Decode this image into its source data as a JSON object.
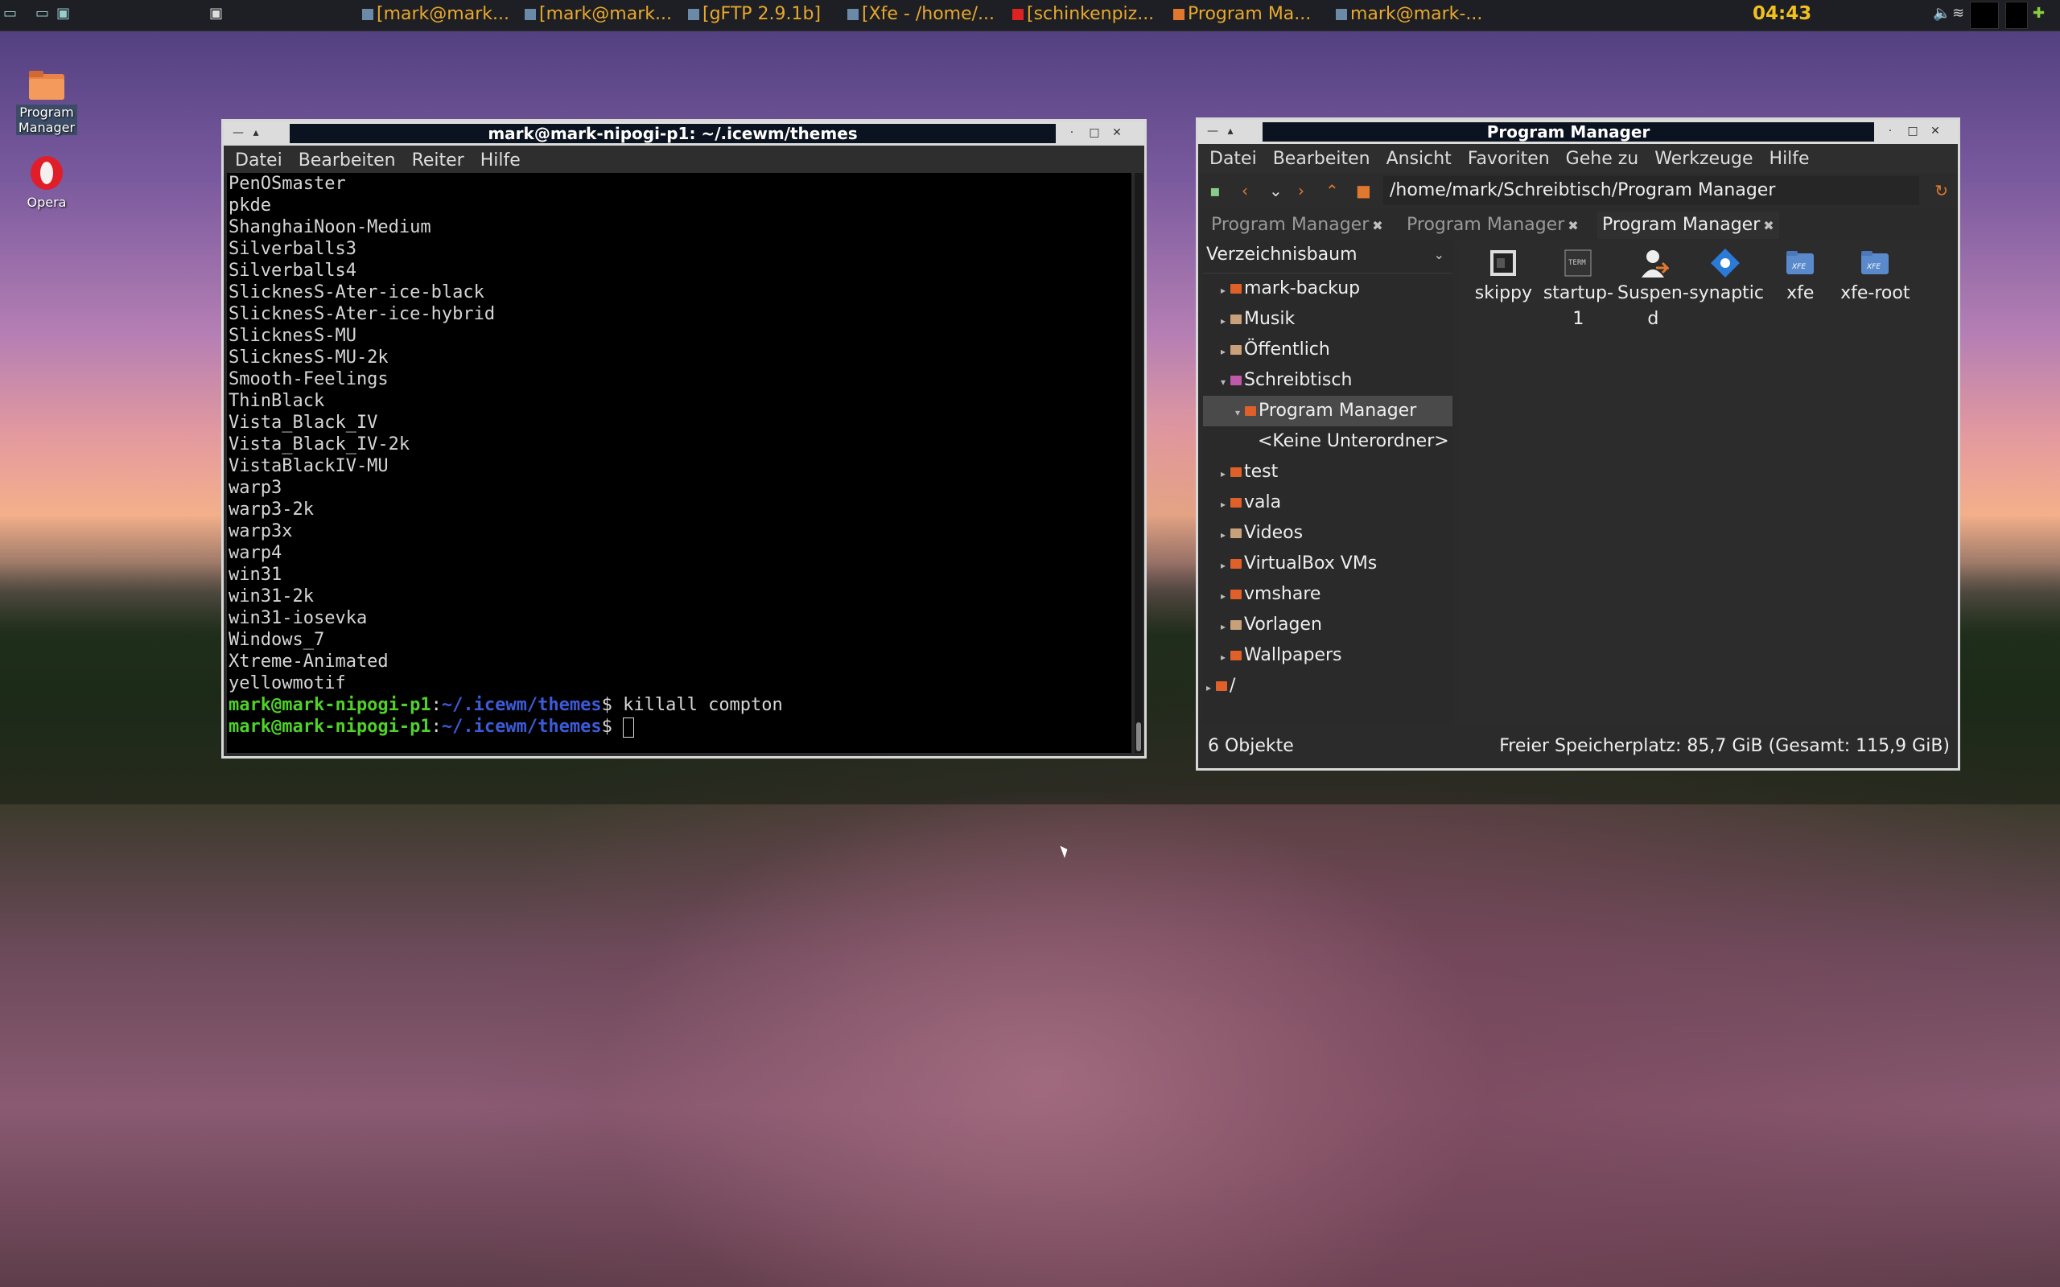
{
  "taskbar": {
    "tasks": [
      {
        "label": "[mark@mark..."
      },
      {
        "label": "[mark@mark..."
      },
      {
        "label": "[gFTP 2.9.1b]"
      },
      {
        "label": "[Xfe - /home/..."
      },
      {
        "label": "[schinkenpiz..."
      },
      {
        "label": "Program Ma..."
      },
      {
        "label": "mark@mark-..."
      }
    ],
    "clock": "04:43"
  },
  "desktop": {
    "icons": [
      {
        "label": "Program Manager",
        "icon": "folder-icon"
      },
      {
        "label": "Opera",
        "icon": "opera-icon"
      }
    ]
  },
  "terminal": {
    "title": "mark@mark-nipogi-p1: ~/.icewm/themes",
    "menu": [
      "Datei",
      "Bearbeiten",
      "Reiter",
      "Hilfe"
    ],
    "lines": [
      "PenOSmaster",
      "pkde",
      "ShanghaiNoon-Medium",
      "Silverballs3",
      "Silverballs4",
      "SlicknesS-Ater-ice-black",
      "SlicknesS-Ater-ice-hybrid",
      "SlicknesS-MU",
      "SlicknesS-MU-2k",
      "Smooth-Feelings",
      "ThinBlack",
      "Vista_Black_IV",
      "Vista_Black_IV-2k",
      "VistaBlackIV-MU",
      "warp3",
      "warp3-2k",
      "warp3x",
      "warp4",
      "win31",
      "win31-2k",
      "win31-iosevka",
      "Windows_7",
      "Xtreme-Animated",
      "yellowmotif"
    ],
    "prompt_user": "mark@mark-nipogi-p1",
    "prompt_sep": ":",
    "prompt_path": "~/.icewm/themes",
    "prompt_dollar": "$",
    "last_command": "killall compton"
  },
  "xfe": {
    "title": "Program Manager",
    "menu": [
      "Datei",
      "Bearbeiten",
      "Ansicht",
      "Favoriten",
      "Gehe zu",
      "Werkzeuge",
      "Hilfe"
    ],
    "address": "/home/mark/Schreibtisch/Program Manager",
    "tabs": [
      {
        "label": "Program Manager",
        "active": false
      },
      {
        "label": "Program Manager",
        "active": false
      },
      {
        "label": "Program Manager",
        "active": true
      }
    ],
    "tree_header": "Verzeichnisbaum",
    "tree": [
      {
        "label": "mark-backup",
        "indent": 0,
        "arrow": "▸",
        "icon": "folder-icon"
      },
      {
        "label": "Musik",
        "indent": 0,
        "arrow": "▸",
        "icon": "music-folder-icon"
      },
      {
        "label": "Öffentlich",
        "indent": 0,
        "arrow": "▸",
        "icon": "public-folder-icon"
      },
      {
        "label": "Schreibtisch",
        "indent": 0,
        "arrow": "▾",
        "icon": "desktop-folder-icon"
      },
      {
        "label": "Program Manager",
        "indent": 1,
        "arrow": "▾",
        "icon": "folder-icon",
        "selected": true
      },
      {
        "label": "<Keine Unterordner>",
        "indent": 2,
        "arrow": "",
        "icon": ""
      },
      {
        "label": "test",
        "indent": 0,
        "arrow": "▸",
        "icon": "folder-icon"
      },
      {
        "label": "vala",
        "indent": 0,
        "arrow": "▸",
        "icon": "folder-icon"
      },
      {
        "label": "Videos",
        "indent": 0,
        "arrow": "▸",
        "icon": "video-folder-icon"
      },
      {
        "label": "VirtualBox VMs",
        "indent": 0,
        "arrow": "▸",
        "icon": "folder-icon"
      },
      {
        "label": "vmshare",
        "indent": 0,
        "arrow": "▸",
        "icon": "folder-icon"
      },
      {
        "label": "Vorlagen",
        "indent": 0,
        "arrow": "▸",
        "icon": "templates-folder-icon"
      },
      {
        "label": "Wallpapers",
        "indent": 0,
        "arrow": "▸",
        "icon": "folder-icon"
      },
      {
        "label": "/",
        "indent": -1,
        "arrow": "▸",
        "icon": "folder-icon"
      }
    ],
    "files": [
      {
        "label": "skippy",
        "icon": "skippy-icon"
      },
      {
        "label": "startup-1",
        "icon": "terminal-icon"
      },
      {
        "label": "Suspen-d",
        "icon": "user-icon"
      },
      {
        "label": "synaptic",
        "icon": "synaptic-icon"
      },
      {
        "label": "xfe",
        "icon": "xfe-folder-icon"
      },
      {
        "label": "xfe-root",
        "icon": "xfe-folder-icon"
      }
    ],
    "status_left": "6 Objekte",
    "status_right": "Freier Speicherplatz: 85,7 GiB (Gesamt: 115,9 GiB)"
  }
}
